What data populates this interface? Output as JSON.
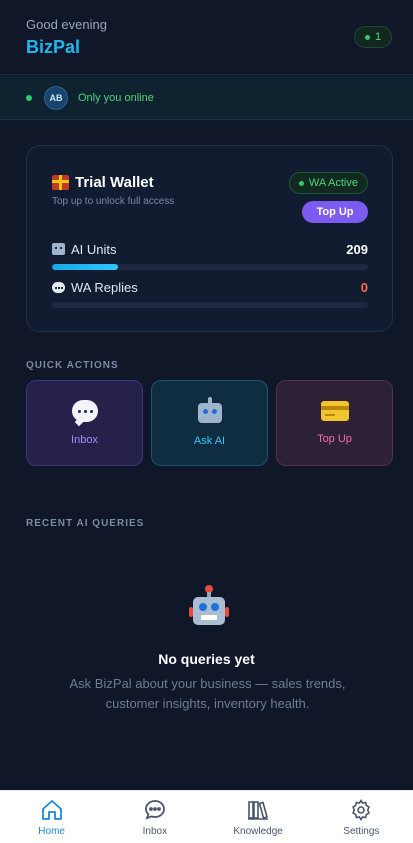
{
  "header": {
    "greeting": "Good evening",
    "brand": "BizPal",
    "notification_count": "1"
  },
  "presence": {
    "avatar_initials": "AB",
    "status_text": "Only you online"
  },
  "wallet": {
    "title": "Trial Wallet",
    "subtitle": "Top up to unlock full access",
    "status_badge": "WA Active",
    "topup_label": "Top Up",
    "metrics": [
      {
        "label": "AI Units",
        "value": "209",
        "progress": 0.21
      },
      {
        "label": "WA Replies",
        "value": "0",
        "progress": 0
      }
    ]
  },
  "quick_actions": {
    "heading": "QUICK ACTIONS",
    "items": [
      {
        "label": "Inbox",
        "icon": "chat-bubble-icon"
      },
      {
        "label": "Ask AI",
        "icon": "robot-icon"
      },
      {
        "label": "Top Up",
        "icon": "credit-card-icon"
      }
    ]
  },
  "recent": {
    "heading": "RECENT AI QUERIES",
    "empty_title": "No queries yet",
    "empty_description": "Ask BizPal about your business — sales trends, customer insights, inventory health."
  },
  "tabbar": {
    "items": [
      {
        "label": "Home",
        "icon": "home-icon",
        "active": true
      },
      {
        "label": "Inbox",
        "icon": "chat-icon",
        "active": false
      },
      {
        "label": "Knowledge",
        "icon": "books-icon",
        "active": false
      },
      {
        "label": "Settings",
        "icon": "gear-icon",
        "active": false
      }
    ]
  },
  "colors": {
    "background": "#0f1729",
    "accent": "#1fb6f0",
    "success": "#2ecc71",
    "danger": "#ff6b4a",
    "purple": "#7c5cf0",
    "tab_active": "#1e88d6"
  }
}
